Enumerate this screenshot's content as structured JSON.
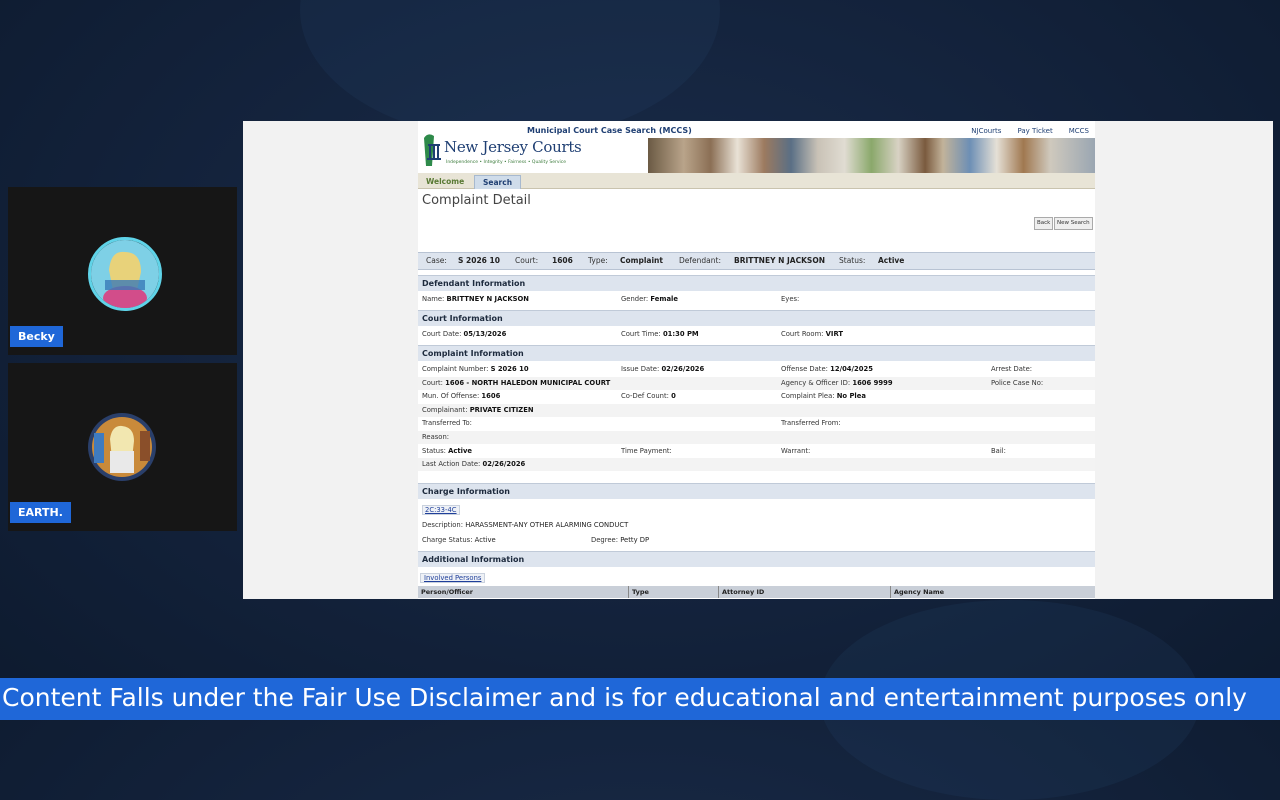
{
  "participants": [
    {
      "name": "Becky"
    },
    {
      "name": "EARTH."
    }
  ],
  "site": {
    "app_title": "Municipal Court Case Search (MCCS)",
    "top_links": [
      "NJCourts",
      "Pay Ticket",
      "MCCS"
    ],
    "logo_text": "New Jersey Courts",
    "logo_tagline": "Independence • Integrity • Fairness • Quality Service",
    "tabs": [
      "Welcome",
      "Search"
    ],
    "active_tab": "Search"
  },
  "page": {
    "title": "Complaint Detail",
    "buttons": {
      "back": "Back",
      "new_search": "New Search"
    }
  },
  "summary": {
    "case_label": "Case:",
    "case": "S 2026 10",
    "court_label": "Court:",
    "court": "1606",
    "type_label": "Type:",
    "type": "Complaint",
    "defendant_label": "Defendant:",
    "defendant": "BRITTNEY N JACKSON",
    "status_label": "Status:",
    "status": "Active"
  },
  "defendant": {
    "heading": "Defendant Information",
    "name_label": "Name:",
    "name": "BRITTNEY N JACKSON",
    "gender_label": "Gender:",
    "gender": "Female",
    "eyes_label": "Eyes:"
  },
  "court": {
    "heading": "Court Information",
    "date_label": "Court Date:",
    "date": "05/13/2026",
    "time_label": "Court Time:",
    "time": "01:30 PM",
    "room_label": "Court Room:",
    "room": "VIRT"
  },
  "complaint": {
    "heading": "Complaint Information",
    "number_label": "Complaint Number:",
    "number": "S 2026 10",
    "issue_label": "Issue Date:",
    "issue": "02/26/2026",
    "offense_label": "Offense Date:",
    "offense": "12/04/2025",
    "arrest_label": "Arrest Date:",
    "court_label": "Court:",
    "court": "1606 - NORTH HALEDON MUNICIPAL COURT",
    "agency_label": "Agency & Officer ID:",
    "agency": "1606 9999",
    "police_label": "Police Case No:",
    "mun_label": "Mun. Of Offense:",
    "mun": "1606",
    "codef_label": "Co-Def Count:",
    "codef": "0",
    "plea_label": "Complaint Plea:",
    "plea": "No Plea",
    "complainant_label": "Complainant:",
    "complainant": "PRIVATE CITIZEN",
    "transferred_to_label": "Transferred To:",
    "transferred_from_label": "Transferred From:",
    "reason_label": "Reason:",
    "status_label": "Status:",
    "status": "Active",
    "time_payment_label": "Time Payment:",
    "warrant_label": "Warrant:",
    "bail_label": "Bail:",
    "last_action_label": "Last Action Date:",
    "last_action": "02/26/2026"
  },
  "charge": {
    "heading": "Charge Information",
    "statute": "2C:33-4C",
    "desc_label": "Description:",
    "desc": "HARASSMENT-ANY OTHER ALARMING CONDUCT",
    "status_label": "Charge Status:",
    "status": "Active",
    "degree_label": "Degree:",
    "degree": "Petty DP"
  },
  "additional": {
    "heading": "Additional Information",
    "tab": "Involved Persons",
    "columns": [
      "Person/Officer",
      "Type",
      "Attorney ID",
      "Agency Name"
    ]
  },
  "ticker": "Content Falls under the Fair Use Disclaimer and is for educational and entertainment purposes only",
  "colors": {
    "name_tag": "#1f67d8",
    "ticker_bg": "#1f67d8",
    "section_bg": "#dde4ee"
  }
}
